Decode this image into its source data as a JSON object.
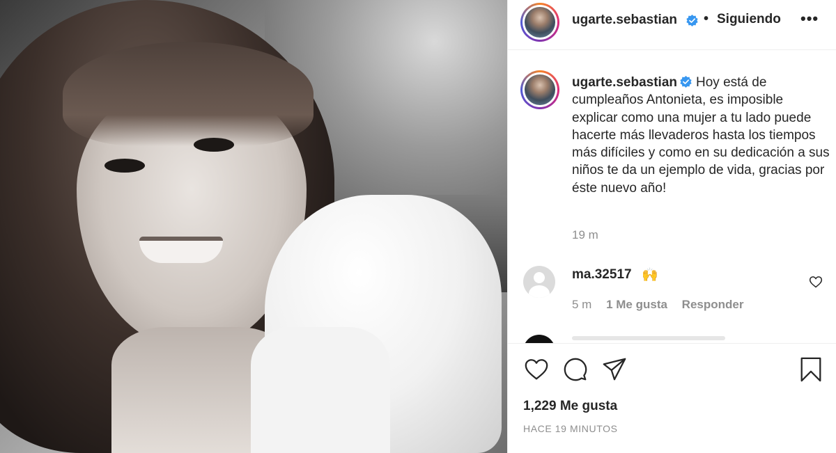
{
  "post": {
    "username": "ugarte.sebastian",
    "follow_status": "Siguiendo",
    "separator": "•",
    "more_label": "•••",
    "caption": "Hoy está de cumpleaños Antonieta, es imposible explicar como una mujer a tu lado puede hacerte más llevaderos hasta los tiempos más difíciles y como en su dedicación a sus niños te da un ejemplo de vida, gracias por éste nuevo año!",
    "caption_time": "19 m"
  },
  "comment": {
    "username": "ma.32517",
    "text": "🙌",
    "time": "5 m",
    "likes": "1 Me gusta",
    "reply": "Responder"
  },
  "footer": {
    "likes": "1,229 Me gusta",
    "posted_ago": "HACE 19 MINUTOS"
  },
  "icons": {
    "like": "heart-icon",
    "comment": "comment-icon",
    "share": "share-icon",
    "save": "bookmark-icon",
    "verified": "verified-badge-icon",
    "comment_like": "heart-icon"
  },
  "colors": {
    "verified": "#3897f0",
    "text": "#262626",
    "muted": "#8e8e8e",
    "divider": "#efefef"
  }
}
